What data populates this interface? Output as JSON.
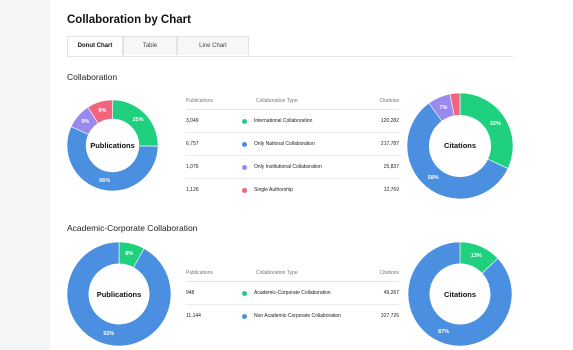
{
  "page": {
    "title": "Collaboration by Chart",
    "tabs": [
      {
        "label": "Donut Chart",
        "active": true
      },
      {
        "label": "Table",
        "active": false
      },
      {
        "label": "Line Chart",
        "active": false
      }
    ]
  },
  "sections": [
    {
      "title": "Collaboration",
      "table": {
        "headers": [
          "Publications",
          "Collaboration Type",
          "Citations"
        ],
        "rows": [
          {
            "publications": "3,049",
            "type": "International Collaboration",
            "citations": "120,282",
            "color": "#1fd17f"
          },
          {
            "publications": "6,757",
            "type": "Only National Collaboration",
            "citations": "217,787",
            "color": "#4a8fe0"
          },
          {
            "publications": "1,076",
            "type": "Only Institutional Collaboration",
            "citations": "25,837",
            "color": "#9a8af0"
          },
          {
            "publications": "1,126",
            "type": "Single Authorship",
            "citations": "12,769",
            "color": "#f2637e"
          }
        ]
      },
      "donut_publications": {
        "center_label": "Publications",
        "slices": [
          {
            "value": 25,
            "label": "25%",
            "color": "#1fd17f"
          },
          {
            "value": 56,
            "label": "56%",
            "color": "#4a8fe0"
          },
          {
            "value": 9,
            "label": "9%",
            "color": "#9a8af0"
          },
          {
            "value": 9,
            "label": "9%",
            "color": "#f2637e"
          }
        ]
      },
      "donut_citations": {
        "center_label": "Citations",
        "slices": [
          {
            "value": 32,
            "label": "32%",
            "color": "#1fd17f"
          },
          {
            "value": 58,
            "label": "58%",
            "color": "#4a8fe0"
          },
          {
            "value": 7,
            "label": "7%",
            "color": "#9a8af0"
          },
          {
            "value": 3,
            "label": "",
            "color": "#f2637e"
          }
        ]
      }
    },
    {
      "title": "Academic-Corporate Collaboration",
      "table": {
        "headers": [
          "Publications",
          "Collaboration Type",
          "Citations"
        ],
        "rows": [
          {
            "publications": "948",
            "type": "Academic-Corporate Collaboration",
            "citations": "49,267",
            "color": "#1fd17f"
          },
          {
            "publications": "11,144",
            "type": "Non Academic-Corporate Collaboration",
            "citations": "327,726",
            "color": "#4a8fe0"
          }
        ]
      },
      "donut_publications": {
        "center_label": "Publications",
        "slices": [
          {
            "value": 8,
            "label": "8%",
            "color": "#1fd17f"
          },
          {
            "value": 92,
            "label": "92%",
            "color": "#4a8fe0"
          }
        ]
      },
      "donut_citations": {
        "center_label": "Citations",
        "slices": [
          {
            "value": 13,
            "label": "13%",
            "color": "#1fd17f"
          },
          {
            "value": 87,
            "label": "87%",
            "color": "#4a8fe0"
          }
        ]
      }
    }
  ]
}
